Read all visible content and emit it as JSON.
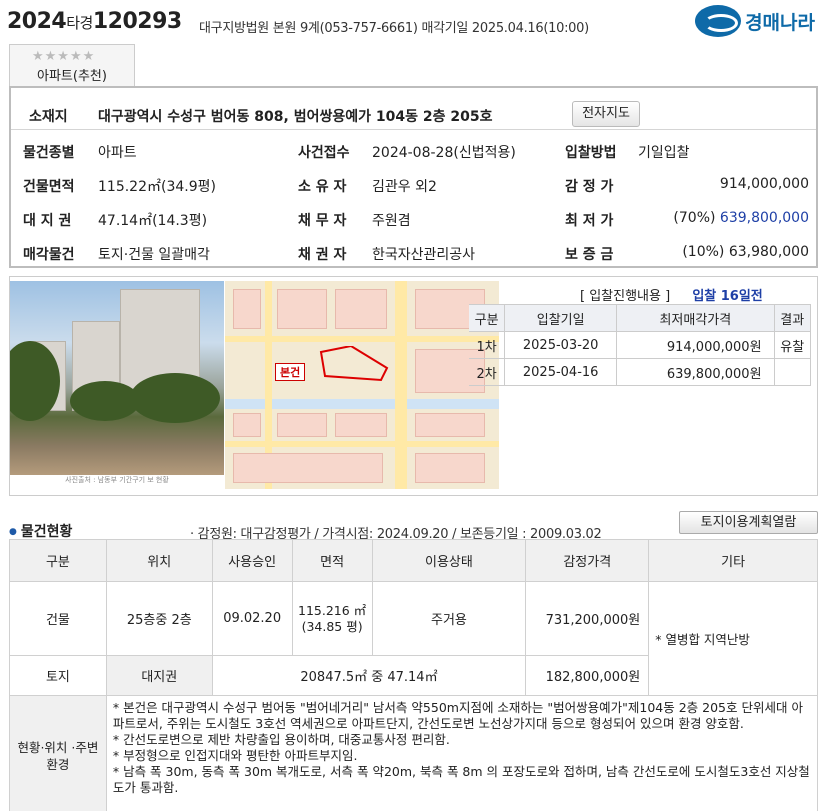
{
  "header": {
    "case_year": "2024",
    "case_kind": "타경",
    "case_number": "120293",
    "court_info": "대구지방법원 본원 9계(053-757-6661) 매각기일 2025.04.16(10:00)",
    "logo_text": "경매나라"
  },
  "tag": {
    "stars": "★★★★★",
    "label": "아파트(추천)"
  },
  "info": {
    "address_label": "소재지",
    "address": "대구광역시 수성구 범어동 808, 범어쌍용예가 104동 2층 205호",
    "map_button": "전자지도",
    "rows": [
      {
        "l1": "물건종별",
        "v1": "아파트",
        "l2": "사건접수",
        "v2": "2024-08-28(신법적용)",
        "l3": "입찰방법",
        "v3": "기일입찰",
        "v3pre": ""
      },
      {
        "l1": "건물면적",
        "v1": "115.22㎡(34.9평)",
        "l2": "소 유 자",
        "v2": "김관우 외2",
        "l3": "감 정 가",
        "v3": "914,000,000",
        "v3pre": ""
      },
      {
        "l1": "대 지 권",
        "v1": "47.14㎡(14.3평)",
        "l2": "채 무 자",
        "v2": "주원겸",
        "l3": "최 저 가",
        "v3": "639,800,000",
        "v3pre": "(70%) "
      },
      {
        "l1": "매각물건",
        "v1": "토지·건물 일괄매각",
        "l2": "채 권 자",
        "v2": "한국자산관리공사",
        "l3": "보 증 금",
        "v3": "63,980,000",
        "v3pre": "(10%) "
      }
    ]
  },
  "photo": {
    "caption": "사진출처 : 남동부 기간구기 보 현황"
  },
  "map": {
    "parcel_label": "본건"
  },
  "bid": {
    "header_link": "[ 입찰진행내용 ]",
    "days_left": "입찰 16일전",
    "columns": [
      "구분",
      "입찰기일",
      "최저매각가격",
      "결과"
    ],
    "rows": [
      {
        "round": "1차",
        "date": "2025-03-20",
        "price": "914,000,000원",
        "result": "유찰"
      },
      {
        "round": "2차",
        "date": "2025-04-16",
        "price": "639,800,000원",
        "result": ""
      }
    ]
  },
  "status": {
    "title": "물건현황",
    "meta": "· 감정원: 대구감정평가 / 가격시점: 2024.09.20 / 보존등기일 : 2009.03.02",
    "plan_button": "토지이용계획열람",
    "columns": [
      "구분",
      "위치",
      "사용승인",
      "면적",
      "이용상태",
      "감정가격",
      "기타"
    ],
    "building": {
      "kind": "건물",
      "location": "25층중 2층",
      "approval": "09.02.20",
      "area": "115.216 ㎡ (34.85 평)",
      "use": "주거용",
      "price": "731,200,000원"
    },
    "other_note": "* 열병합 지역난방",
    "land": {
      "kind": "토지",
      "location": "대지권",
      "area": "20847.5㎡ 중 47.14㎡",
      "price": "182,800,000원"
    },
    "env_label": "현황·위치 ·주변환경",
    "env_lines": [
      "* 본건은 대구광역시 수성구 범어동 \"범어네거리\" 남서측 약550m지점에 소재하는 \"범어쌍용예가\"제104동 2층 205호 단위세대 아파트로서, 주위는 도시철도 3호선 역세권으로 아파트단지, 간선도로변 노선상가지대 등으로 형성되어 있으며 환경 양호함.",
      "* 간선도로변으로 제반 차량출입 용이하며, 대중교통사정 편리함.",
      "* 부정형으로 인접지대와 평탄한 아파트부지임.",
      "* 남측 폭 30m, 동측 폭 30m 복개도로, 서측 폭 약20m, 북측 폭 8m 의 포장도로와 접하며, 남측 간선도로에 도시철도3호선 지상철도가 통과함."
    ]
  }
}
